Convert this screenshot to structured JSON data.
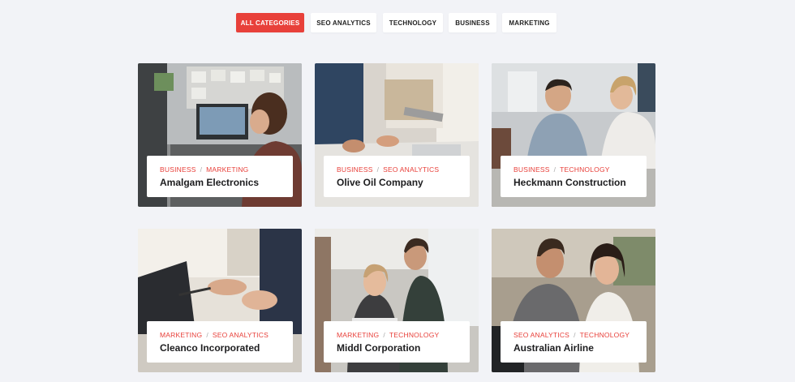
{
  "filters": [
    {
      "label": "ALL CATEGORIES",
      "active": true
    },
    {
      "label": "SEO ANALYTICS",
      "active": false
    },
    {
      "label": "TECHNOLOGY",
      "active": false
    },
    {
      "label": "BUSINESS",
      "active": false
    },
    {
      "label": "MARKETING",
      "active": false
    }
  ],
  "separator": "/",
  "cards": [
    {
      "cat1": "BUSINESS",
      "cat2": "MARKETING",
      "title": "Amalgam Electronics",
      "image": "woman-at-desk-photo"
    },
    {
      "cat1": "BUSINESS",
      "cat2": "SEO ANALYTICS",
      "title": "Olive Oil Company",
      "image": "hands-at-table-photo"
    },
    {
      "cat1": "BUSINESS",
      "cat2": "TECHNOLOGY",
      "title": "Heckmann Construction",
      "image": "team-meeting-photo"
    },
    {
      "cat1": "MARKETING",
      "cat2": "SEO ANALYTICS",
      "title": "Cleanco Incorporated",
      "image": "laptop-discussion-photo"
    },
    {
      "cat1": "MARKETING",
      "cat2": "TECHNOLOGY",
      "title": "Middl Corporation",
      "image": "colleagues-at-screen-photo"
    },
    {
      "cat1": "SEO ANALYTICS",
      "cat2": "TECHNOLOGY",
      "title": "Australian Airline",
      "image": "smiling-coworkers-photo"
    }
  ],
  "colors": {
    "accent": "#e8403a",
    "background": "#f2f3f7",
    "title": "#1d1d1f"
  }
}
